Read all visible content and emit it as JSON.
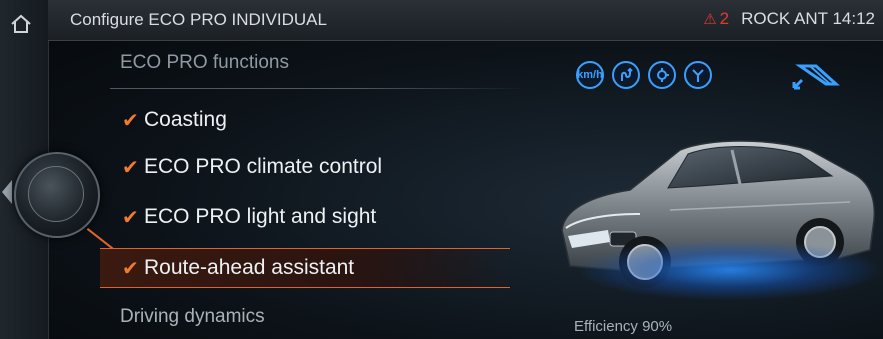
{
  "header": {
    "title": "Configure ECO PRO INDIVIDUAL",
    "warning_count": "2",
    "status_text": "ROCK ANT",
    "time": "14:12"
  },
  "menu": {
    "section_title": "ECO PRO functions",
    "items": [
      {
        "label": "Coasting",
        "checked": true
      },
      {
        "label": "ECO PRO climate control",
        "checked": true
      },
      {
        "label": "ECO PRO light and sight",
        "checked": true
      },
      {
        "label": "Route-ahead assistant",
        "checked": true,
        "selected": true
      }
    ],
    "next_section": "Driving dynamics"
  },
  "icons": {
    "speed_label": "km/h",
    "names": [
      "speed-limit-icon",
      "route-icon",
      "roundabout-icon",
      "junction-icon",
      "coasting-icon"
    ]
  },
  "status": {
    "efficiency": "Efficiency 90%"
  },
  "colors": {
    "accent": "#e0642a",
    "check": "#f07a2e",
    "icon_blue": "#3aa0ff",
    "warning": "#e03a2e"
  }
}
